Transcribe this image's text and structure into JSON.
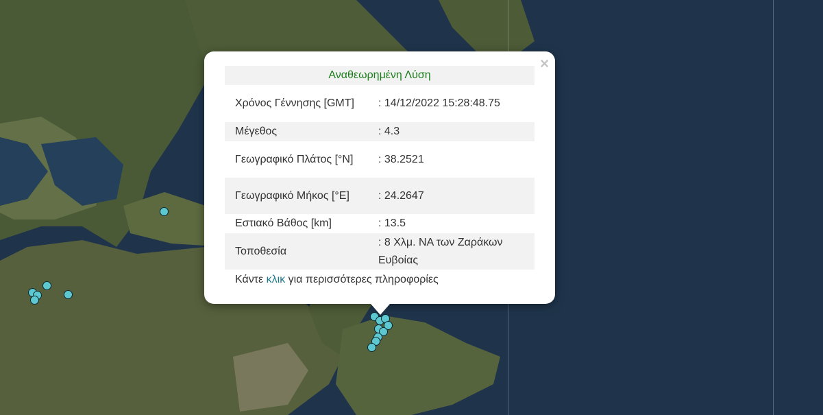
{
  "popup": {
    "title": "Αναθεωρημένη Λύση",
    "close": "×",
    "rows": [
      {
        "label": "Χρόνος Γέννησης [GMT]",
        "value": ": 14/12/2022 15:28:48.75"
      },
      {
        "label": "Μέγεθος",
        "value": ": 4.3"
      },
      {
        "label": "Γεωγραφικό Πλάτος [°N]",
        "value": ": 38.2521"
      },
      {
        "label": "Γεωγραφικό Μήκος [°E]",
        "value": ": 24.2647"
      },
      {
        "label": "Εστιακό Βάθος [km]",
        "value": ": 13.5"
      },
      {
        "label": "Τοποθεσία",
        "value": ": 8 Χλμ. ΝΑ των Ζαράκων Ευβοίας"
      }
    ],
    "more_prefix": "Κάντε",
    "more_link": "κλικ",
    "more_suffix": "για περισσότερες πληροφορίες"
  },
  "colors": {
    "marker": "#5ec8d1",
    "title": "#1b7d1b",
    "link": "#1f7a8c"
  }
}
